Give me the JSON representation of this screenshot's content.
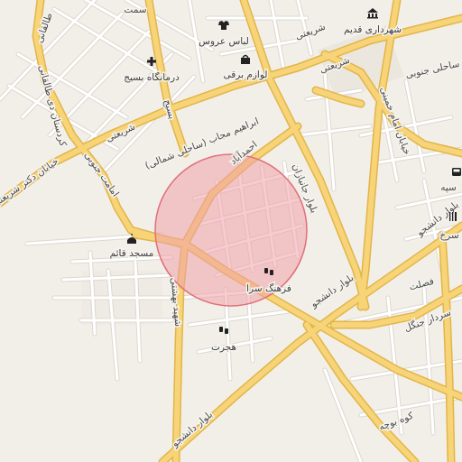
{
  "map": {
    "colors": {
      "background": "#f2efe9",
      "major_road": "#f6d06e",
      "major_road_casing": "#e0b445",
      "minor_road": "#ffffff",
      "minor_road_casing": "#d8d4cc",
      "search_circle_fill": "#f0a0a8",
      "search_circle_stroke": "#e0707a"
    },
    "highlight_circle": {
      "shape": "circle",
      "meaning": "search-radius-area"
    },
    "streets": {
      "shariati_1": "شریعتی",
      "shariati_2": "شریعتی",
      "shariati_3": "شریعتی",
      "taleghani": "طالقانی",
      "kordestan_taleghani": "کردستان دی طالقانی",
      "khiyaban_dr": "خیابان دکتر شریعتی",
      "emamat_jonubi": "امامت جنوبی",
      "ebrahim_mojab": "ابراهیم مجاب (ساحلی شمالی)",
      "ahmadabad": "احمدآباد",
      "basij": "بسیج",
      "janbazan": "بلوار جانبازان",
      "daneshjoo_1": "بلوار دانشجو",
      "daneshjoo_2": "بلوار دانشجو",
      "daneshjoo_3": "بلوار دانشجو",
      "shahid_beheshti": "شهید بهشتی",
      "sahel_jonubi": "ساحلی جنوبی",
      "imam_khomeini": "خیابان امام خمینی",
      "saqafat": "فصلت",
      "sardar_jangal": "سردار جنگل",
      "kooh_booche": "کوه بوچه",
      "sahm_sorkh": "سرخ",
      "sepah": "سپه",
      "top_left_frag": "سمت"
    },
    "pois": [
      {
        "icon": "shirt-icon",
        "label": "لباس عروس"
      },
      {
        "icon": "building-icon",
        "label": "شهرداری قدیم"
      },
      {
        "icon": "medical-cross-icon",
        "label": "درمانگاه بسیج"
      },
      {
        "icon": "shopping-bag-icon",
        "label": "لوازم برقی"
      },
      {
        "icon": "mosque-icon",
        "label": "مسجد قائم"
      },
      {
        "icon": "theater-icon",
        "label": "فرهنگ سرا"
      },
      {
        "icon": "theater-icon",
        "label": "هجرت"
      },
      {
        "icon": "restaurant-icon",
        "label": ""
      },
      {
        "icon": "bus-icon",
        "label": ""
      }
    ]
  }
}
